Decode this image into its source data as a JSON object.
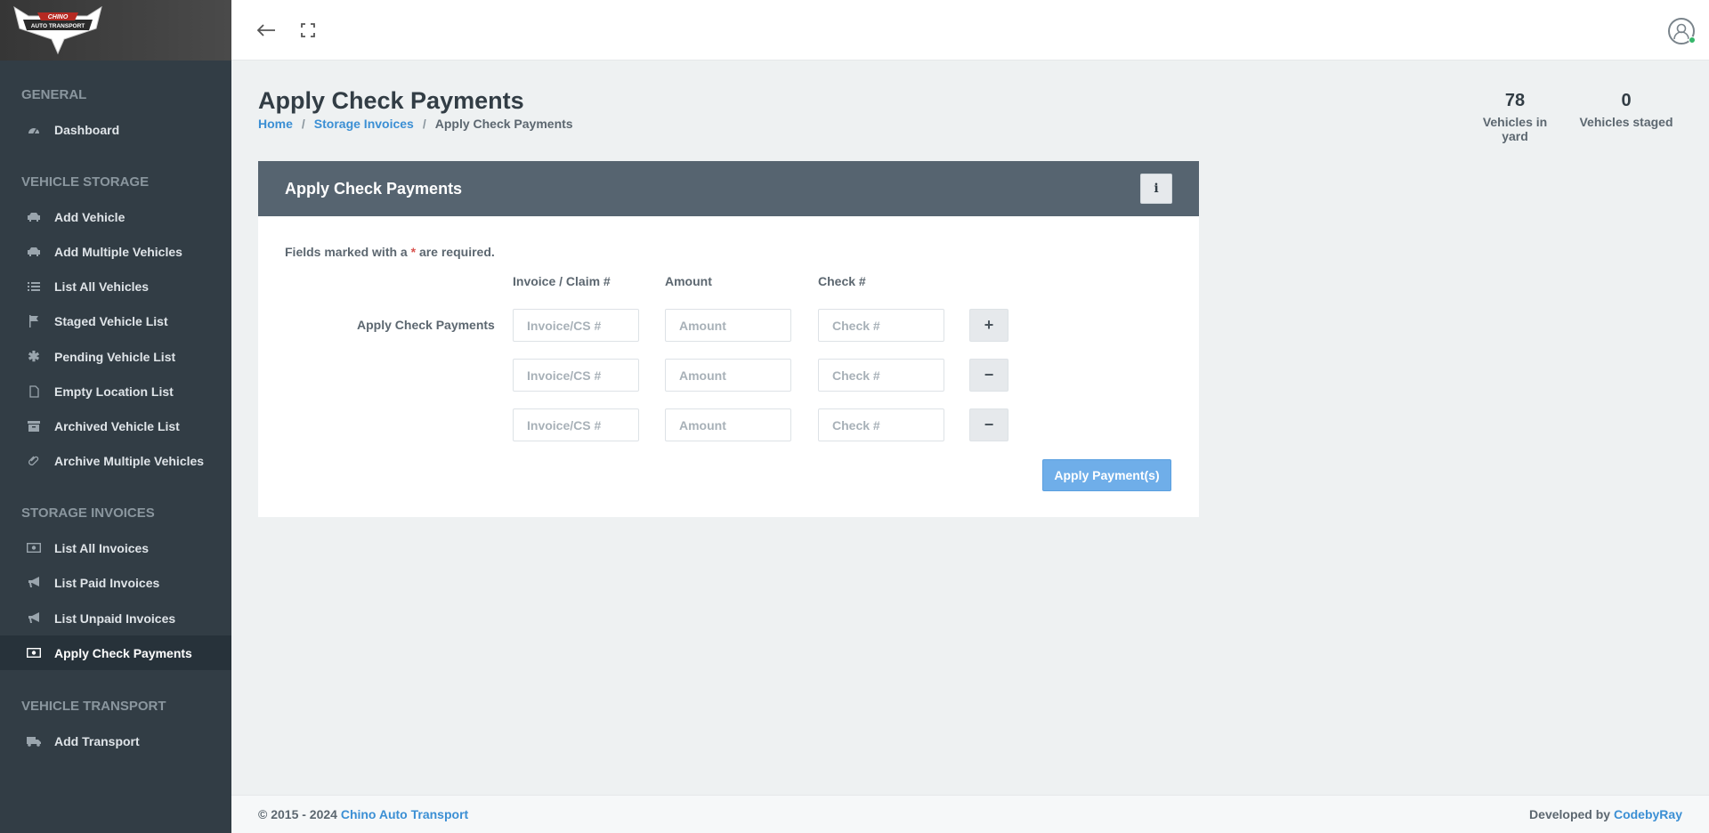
{
  "brand": {
    "logo_text_top": "CHINO",
    "logo_text_bottom": "AUTO TRANSPORT"
  },
  "sidebar": {
    "sections": [
      {
        "heading": "GENERAL",
        "items": [
          {
            "label": "Dashboard",
            "icon": "dashboard-icon"
          }
        ]
      },
      {
        "heading": "VEHICLE STORAGE",
        "items": [
          {
            "label": "Add Vehicle",
            "icon": "car-icon"
          },
          {
            "label": "Add Multiple Vehicles",
            "icon": "car-icon"
          },
          {
            "label": "List All Vehicles",
            "icon": "list-icon"
          },
          {
            "label": "Staged Vehicle List",
            "icon": "flag-icon"
          },
          {
            "label": "Pending Vehicle List",
            "icon": "asterisk-icon"
          },
          {
            "label": "Empty Location List",
            "icon": "file-icon"
          },
          {
            "label": "Archived Vehicle List",
            "icon": "archive-icon"
          },
          {
            "label": "Archive Multiple Vehicles",
            "icon": "paperclip-icon"
          }
        ]
      },
      {
        "heading": "STORAGE INVOICES",
        "items": [
          {
            "label": "List All Invoices",
            "icon": "money-icon"
          },
          {
            "label": "List Paid Invoices",
            "icon": "bullhorn-icon"
          },
          {
            "label": "List Unpaid Invoices",
            "icon": "bullhorn-icon"
          },
          {
            "label": "Apply Check Payments",
            "icon": "money-icon",
            "active": true
          }
        ]
      },
      {
        "heading": "VEHICLE TRANSPORT",
        "items": [
          {
            "label": "Add Transport",
            "icon": "truck-icon"
          }
        ]
      }
    ]
  },
  "topbar": {
    "back_icon": "arrow-left-icon",
    "fullscreen_icon": "expand-icon",
    "user_icon": "user-avatar-icon"
  },
  "header": {
    "title": "Apply Check Payments",
    "breadcrumb": {
      "home": "Home",
      "parent": "Storage Invoices",
      "current": "Apply Check Payments",
      "separator": "/"
    },
    "stats": [
      {
        "value": "78",
        "label": "Vehicles in yard"
      },
      {
        "value": "0",
        "label": "Vehicles staged"
      }
    ]
  },
  "form": {
    "title": "Apply Check Payments",
    "info_button": "i",
    "required_note_pre": "Fields marked with a ",
    "required_star": "*",
    "required_note_post": " are required.",
    "columns": {
      "invoice": "Invoice / Claim #",
      "amount": "Amount",
      "check": "Check #"
    },
    "row_label": "Apply Check Payments",
    "placeholders": {
      "invoice": "Invoice/CS #",
      "amount": "Amount",
      "check": "Check #"
    },
    "rows": [
      {
        "invoice": "",
        "amount": "",
        "check": "",
        "action": "+"
      },
      {
        "invoice": "",
        "amount": "",
        "check": "",
        "action": "−"
      },
      {
        "invoice": "",
        "amount": "",
        "check": "",
        "action": "−"
      }
    ],
    "submit_label": "Apply Payment(s)"
  },
  "footer": {
    "copyright": "© 2015 - 2024 ",
    "company": "Chino Auto Transport",
    "developed_by": "Developed by ",
    "developer": "CodebyRay"
  },
  "colors": {
    "sidebar_bg": "#323d45",
    "accent": "#3b8fd4",
    "block_header": "#566470",
    "primary_button": "#6faee9"
  }
}
